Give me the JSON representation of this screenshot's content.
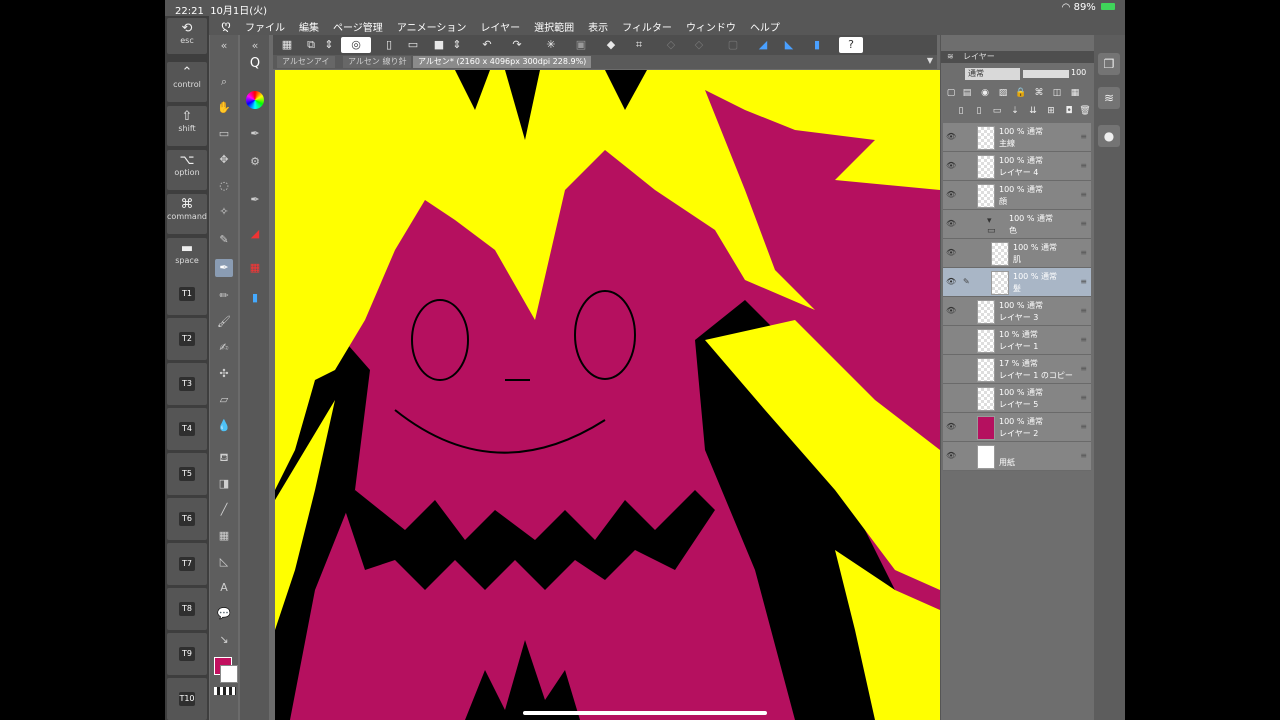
{
  "status": {
    "time": "22:21",
    "date": "10月1日(火)",
    "battery": "89%"
  },
  "menu": {
    "items": [
      "ファイル",
      "編集",
      "ページ管理",
      "アニメーション",
      "レイヤー",
      "選択範囲",
      "表示",
      "フィルター",
      "ウィンドウ",
      "ヘルプ"
    ]
  },
  "keys": [
    {
      "glyph": "⟲",
      "label": "esc"
    },
    {
      "glyph": "⌃",
      "label": "control"
    },
    {
      "glyph": "⇧",
      "label": "shift"
    },
    {
      "glyph": "⌥",
      "label": "option"
    },
    {
      "glyph": "⌘",
      "label": "command"
    },
    {
      "glyph": "▬",
      "label": "space"
    }
  ],
  "tkeys": [
    "T1",
    "T2",
    "T3",
    "T4",
    "T5",
    "T6",
    "T7",
    "T8",
    "T9",
    "T10"
  ],
  "tabs": [
    "アルセンアイ",
    "アルセン 線り針",
    "アルセン* (2160 x 4096px 300dpi 228.9%)"
  ],
  "panel": {
    "title": "レイヤー",
    "blend": "通常",
    "opacity": "100"
  },
  "layers": [
    {
      "pct": "100 % 通常",
      "name": "主線",
      "thumb": "checker",
      "indent": false,
      "selected": false,
      "visible": true
    },
    {
      "pct": "100 % 通常",
      "name": "レイヤー 4",
      "thumb": "checker",
      "indent": false,
      "selected": false,
      "visible": true
    },
    {
      "pct": "100 % 通常",
      "name": "顔",
      "thumb": "checker",
      "indent": false,
      "selected": false,
      "visible": true
    },
    {
      "pct": "100 % 通常",
      "name": "色",
      "thumb": "folder",
      "indent": false,
      "selected": false,
      "visible": true
    },
    {
      "pct": "100 % 通常",
      "name": "肌",
      "thumb": "checker",
      "indent": true,
      "selected": false,
      "visible": true
    },
    {
      "pct": "100 % 通常",
      "name": "髪",
      "thumb": "checker",
      "indent": true,
      "selected": true,
      "visible": true
    },
    {
      "pct": "100 % 通常",
      "name": "レイヤー 3",
      "thumb": "checker",
      "indent": false,
      "selected": false,
      "visible": true
    },
    {
      "pct": "10 % 通常",
      "name": "レイヤー 1",
      "thumb": "checker",
      "indent": false,
      "selected": false,
      "visible": false
    },
    {
      "pct": "17 % 通常",
      "name": "レイヤー 1 のコピー",
      "thumb": "checker",
      "indent": false,
      "selected": false,
      "visible": false
    },
    {
      "pct": "100 % 通常",
      "name": "レイヤー 5",
      "thumb": "checker",
      "indent": false,
      "selected": false,
      "visible": false
    },
    {
      "pct": "100 % 通常",
      "name": "レイヤー 2",
      "thumb": "solid",
      "indent": false,
      "selected": false,
      "visible": true
    },
    {
      "pct": "",
      "name": "用紙",
      "thumb": "white",
      "indent": false,
      "selected": false,
      "visible": true
    }
  ],
  "colors": {
    "main": "#c2105f",
    "hair": "#ffff00",
    "line": "#000000"
  }
}
